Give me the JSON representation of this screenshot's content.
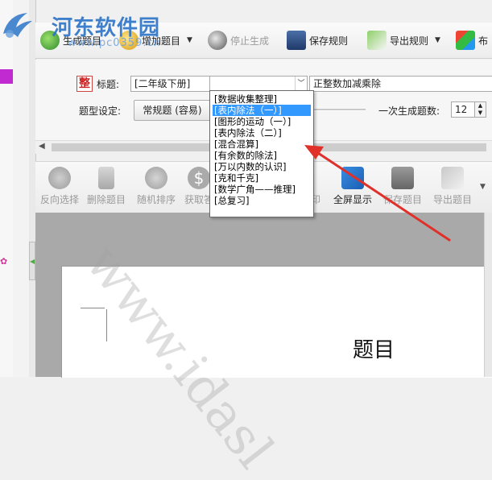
{
  "watermark_logo": {
    "name": "河东软件园",
    "url": "www.pc0359.cn",
    "page_watermark": "www.idasl"
  },
  "top_toolbar": {
    "buttons": [
      {
        "label": "生成题目"
      },
      {
        "label": "增加题目"
      },
      {
        "label": "停止生成"
      },
      {
        "label": "保存规则"
      },
      {
        "label": "导出规则"
      },
      {
        "label": "布"
      }
    ]
  },
  "settings": {
    "title_label": "标题:",
    "title_icon": "整",
    "grade_select": "[二年级下册]",
    "category_select": "",
    "title_value": "正整数加减乘除",
    "question_type_label": "题型设定:",
    "question_type_button": "常规题 (容易)",
    "count_label": "一次生成题数:",
    "count_value": "12"
  },
  "dropdown": {
    "items": [
      "[数据收集整理]",
      "[表内除法（一）]",
      "[图形的运动（一）]",
      "[表内除法（二）]",
      "[混合混算]",
      "[有余数的除法]",
      "[万以内数的认识]",
      "[克和千克]",
      "[数学广角——推理]",
      "[总复习]"
    ],
    "selected_index": 1
  },
  "second_toolbar": {
    "buttons": [
      {
        "label": "反向选择",
        "enabled": false
      },
      {
        "label": "删除题目",
        "enabled": false
      },
      {
        "label": "随机排序",
        "enabled": false
      },
      {
        "label": "获取答",
        "enabled": false
      },
      {
        "label": "印",
        "enabled": false
      },
      {
        "label": "全屏显示",
        "enabled": true
      },
      {
        "label": "保存题目",
        "enabled": false
      },
      {
        "label": "导出题目",
        "enabled": false
      }
    ]
  },
  "document": {
    "title": "题目"
  },
  "colors": {
    "selection": "#3399ff",
    "arrow": "#e0302a",
    "logo_blue": "#2a73c8",
    "left_accent": "#c02ad0"
  }
}
